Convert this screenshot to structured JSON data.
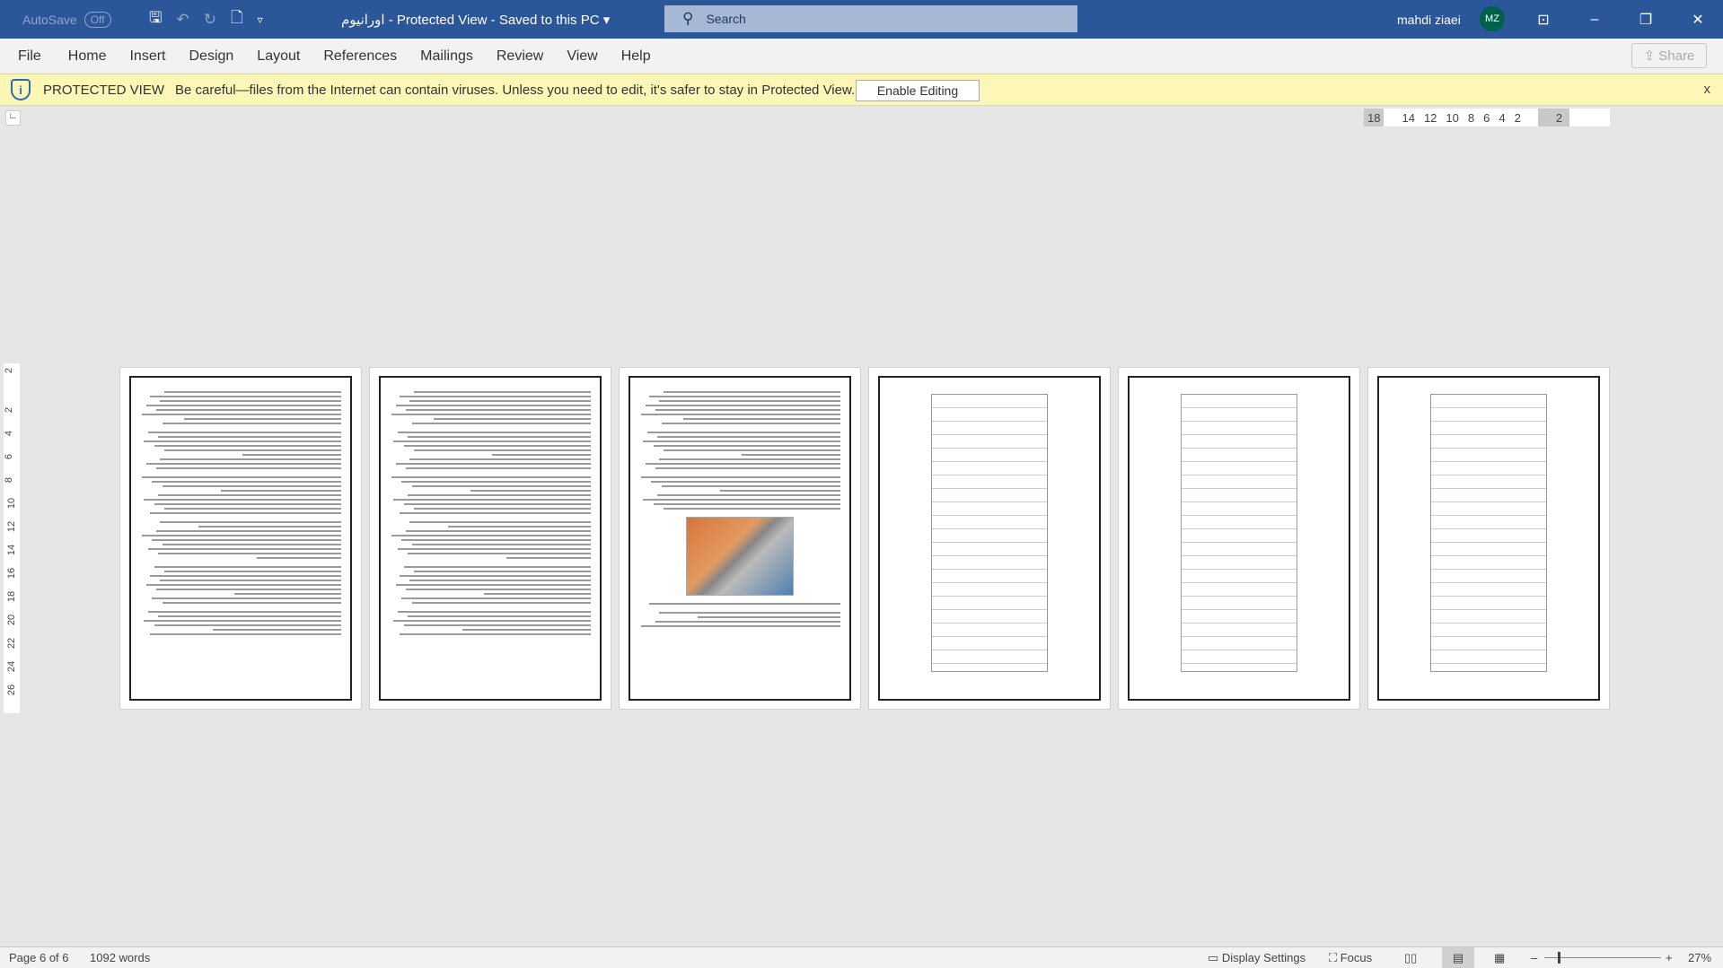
{
  "titlebar": {
    "autosave": "AutoSave",
    "autosave_state": "Off",
    "doc_name": "اورانیوم",
    "title_rest": "-  Protected View  -  Saved to this PC  ▾",
    "search_placeholder": "Search",
    "user_name": "mahdi ziaei",
    "user_initials": "MZ"
  },
  "menu": {
    "items": [
      "File",
      "Home",
      "Insert",
      "Design",
      "Layout",
      "References",
      "Mailings",
      "Review",
      "View",
      "Help"
    ],
    "share": "Share"
  },
  "protected": {
    "label": "PROTECTED VIEW",
    "message": "Be careful—files from the Internet can contain viruses. Unless you need to edit, it's safer to stay in Protected View.",
    "enable": "Enable Editing",
    "close": "x"
  },
  "ruler": {
    "left": "18",
    "ticks": [
      "14",
      "12",
      "10",
      "8",
      "6",
      "4",
      "2"
    ],
    "right": "2"
  },
  "vruler": [
    "2",
    "2",
    "4",
    "6",
    "8",
    "10",
    "12",
    "14",
    "16",
    "18",
    "20",
    "22",
    "24",
    "26"
  ],
  "status": {
    "page": "Page 6 of 6",
    "words": "1092 words",
    "display_settings": "Display Settings",
    "focus": "Focus",
    "zoom": "27%",
    "zoom_level": 27
  },
  "pages": [
    {
      "type": "text"
    },
    {
      "type": "text"
    },
    {
      "type": "image"
    },
    {
      "type": "table"
    },
    {
      "type": "table"
    },
    {
      "type": "table"
    }
  ]
}
